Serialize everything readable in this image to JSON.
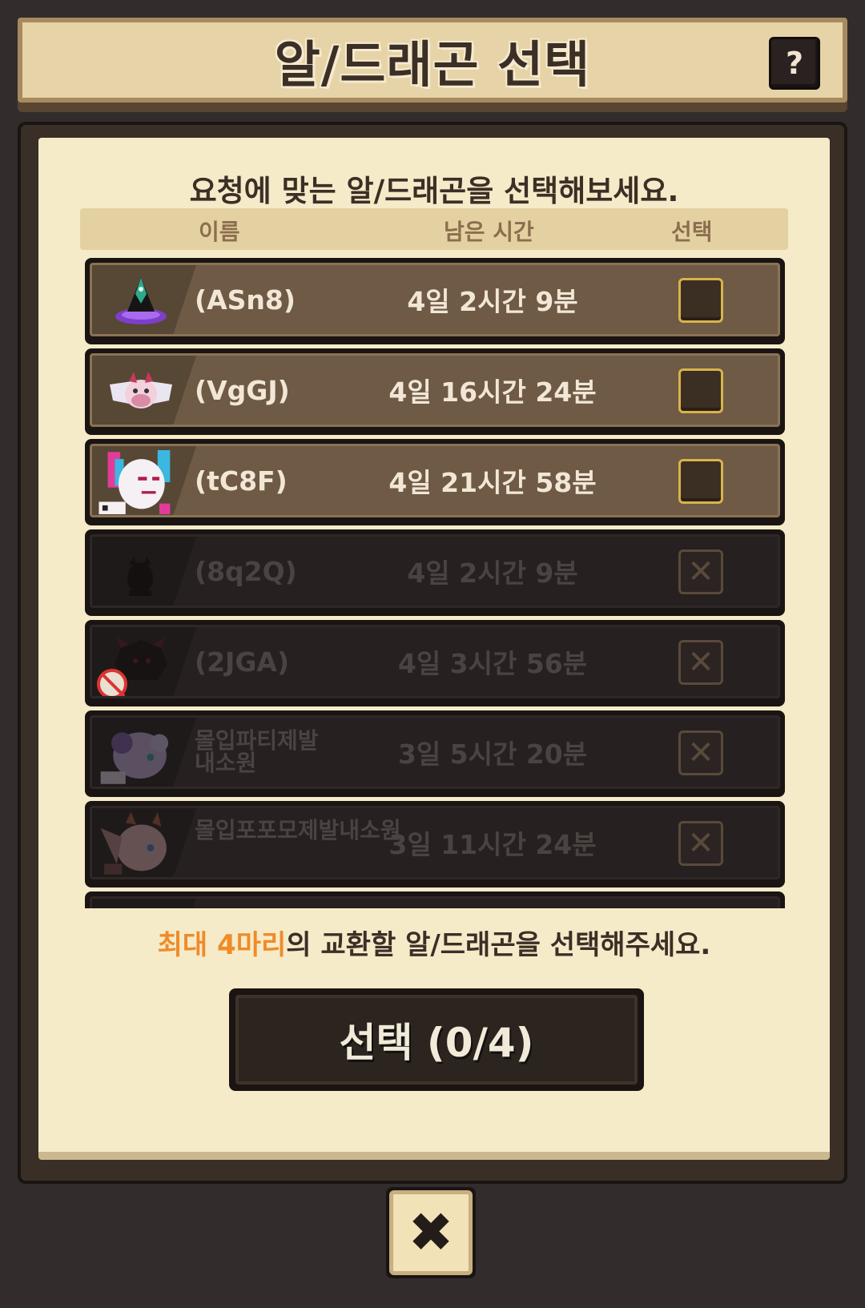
{
  "header": {
    "title": "알/드래곤 선택",
    "help_label": "?"
  },
  "panel": {
    "instruction": "요청에 맞는 알/드래곤을 선택해보세요.",
    "columns": {
      "name": "이름",
      "time": "남은 시간",
      "select": "선택"
    }
  },
  "rows": [
    {
      "name": "(ASn8)",
      "time": "4일 2시간 9분",
      "state": "available",
      "icon": "dark-egg-icon"
    },
    {
      "name": "(VgGJ)",
      "time": "4일 16시간 24분",
      "state": "available",
      "icon": "winged-dragon-icon"
    },
    {
      "name": "(tC8F)",
      "time": "4일 21시간 58분",
      "state": "available",
      "icon": "jester-dragon-icon"
    },
    {
      "name": "(8q2Q)",
      "time": "4일 2시간 9분",
      "state": "disabled",
      "icon": "shadow-egg-icon",
      "check": "✕"
    },
    {
      "name": "(2JGA)",
      "time": "4일 3시간 56분",
      "state": "disabled",
      "icon": "spiky-dragon-icon",
      "check": "✕"
    },
    {
      "name": "몰입파티제발\n내소원",
      "time": "3일 5시간 20분",
      "state": "disabled",
      "icon": "fluffy-dragon-icon",
      "check": "✕"
    },
    {
      "name": "몰입포포모제발내소원",
      "time": "3일 11시간 24분",
      "state": "disabled",
      "icon": "pink-dragon-icon",
      "check": "✕"
    }
  ],
  "footer": {
    "note_highlight": "최대 4마리",
    "note_rest": "의 교환할 알/드래곤을 선택해주세요.",
    "select_button": "선택 (0/4)",
    "close_label": "✖"
  },
  "colors": {
    "background": "#322c2c",
    "panel": "#f5ebc9",
    "row_active": "#6e5a45",
    "row_disabled": "#262020",
    "highlight": "#f08b28",
    "checkbox_border": "#d9b34a"
  }
}
